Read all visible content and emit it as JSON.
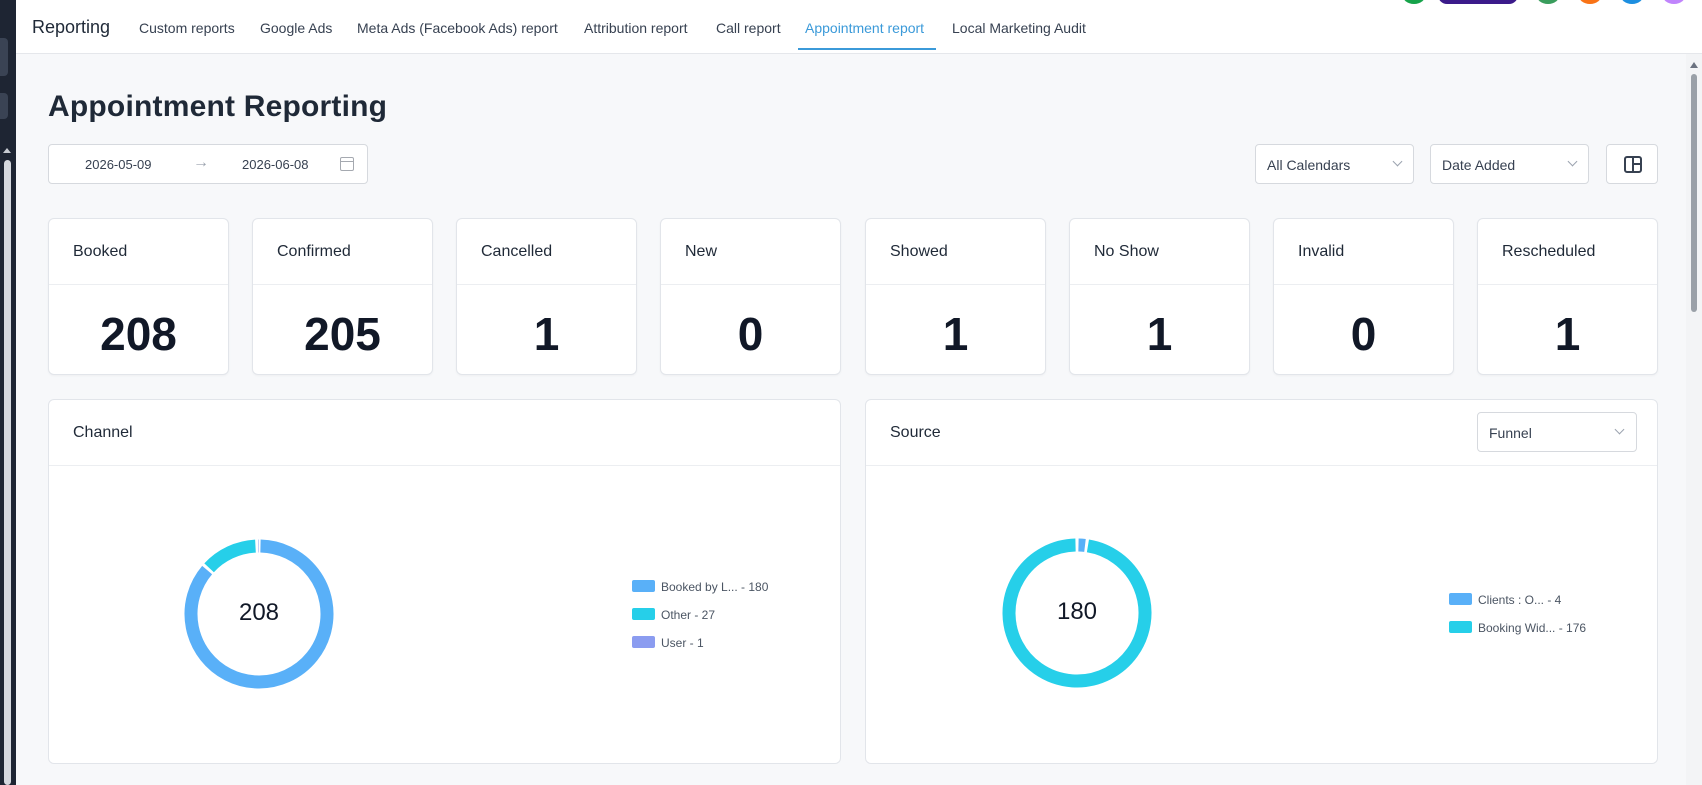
{
  "app": {
    "brand": "Reporting",
    "colors": {
      "accent": "#3b9ad9",
      "chart_blue": "#59b0f8",
      "chart_cyan": "#26cfe9",
      "chart_violet": "#8b9cf0"
    }
  },
  "nav": {
    "tabs": [
      {
        "label": "Custom reports",
        "active": false
      },
      {
        "label": "Google Ads",
        "active": false
      },
      {
        "label": "Meta Ads (Facebook Ads) report",
        "active": false
      },
      {
        "label": "Attribution report",
        "active": false
      },
      {
        "label": "Call report",
        "active": false
      },
      {
        "label": "Appointment report",
        "active": true
      },
      {
        "label": "Local Marketing Audit",
        "active": false
      }
    ]
  },
  "page": {
    "title": "Appointment Reporting"
  },
  "filters": {
    "date_start": "2026-05-09",
    "date_arrow": "→",
    "date_end": "2026-06-08",
    "calendar_select": "All Calendars",
    "date_type_select": "Date Added"
  },
  "stats": [
    {
      "label": "Booked",
      "value": "208"
    },
    {
      "label": "Confirmed",
      "value": "205"
    },
    {
      "label": "Cancelled",
      "value": "1"
    },
    {
      "label": "New",
      "value": "0"
    },
    {
      "label": "Showed",
      "value": "1"
    },
    {
      "label": "No Show",
      "value": "1"
    },
    {
      "label": "Invalid",
      "value": "0"
    },
    {
      "label": "Rescheduled",
      "value": "1"
    }
  ],
  "channel": {
    "title": "Channel",
    "total": "208",
    "legend": [
      {
        "text": "Booked by L... - 180",
        "color": "#59b0f8"
      },
      {
        "text": "Other - 27",
        "color": "#26cfe9"
      },
      {
        "text": "User - 1",
        "color": "#8b9cf0"
      }
    ]
  },
  "source": {
    "title": "Source",
    "select": "Funnel",
    "total": "180",
    "legend": [
      {
        "text": "Clients : O... - 4",
        "color": "#59b0f8"
      },
      {
        "text": "Booking Wid... - 176",
        "color": "#26cfe9"
      }
    ]
  },
  "chart_data": [
    {
      "type": "pie",
      "title": "Channel",
      "categories": [
        "Booked by L...",
        "Other",
        "User"
      ],
      "values": [
        180,
        27,
        1
      ],
      "colors": [
        "#59b0f8",
        "#26cfe9",
        "#8b9cf0"
      ],
      "total": 208,
      "donut": true,
      "legend_placement": "right"
    },
    {
      "type": "pie",
      "title": "Source",
      "categories": [
        "Clients : O...",
        "Booking Wid..."
      ],
      "values": [
        4,
        176
      ],
      "colors": [
        "#59b0f8",
        "#26cfe9"
      ],
      "total": 180,
      "donut": true,
      "legend_placement": "right"
    }
  ]
}
